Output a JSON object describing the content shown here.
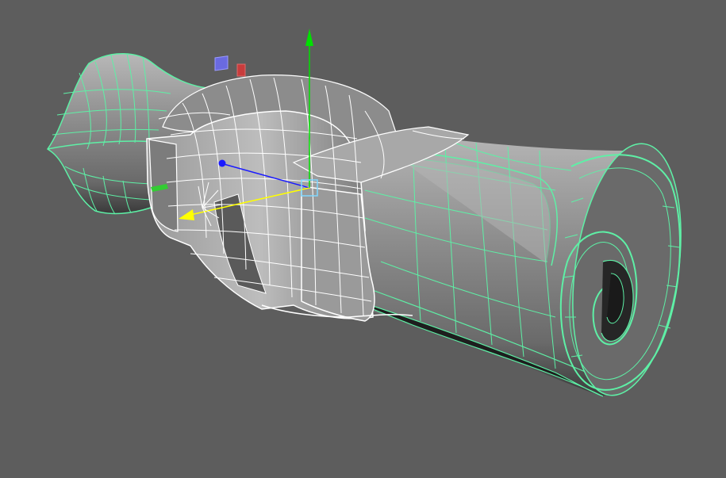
{
  "viewport": {
    "background": "#5d5d5d",
    "wireframe_selected_color": "#5ef0a6",
    "wireframe_active_color": "#ffffff",
    "surface_shade_light": "#b4b4b4",
    "surface_shade_dark": "#3a3a3a"
  },
  "gizmo": {
    "y_axis_color": "#00e000",
    "x_axis_color": "#1a1aff",
    "z_axis_color": "#ffff00",
    "red_handle_color": "#c83c3c",
    "blue_handle_color": "#6a6ae0",
    "green_handle_color": "#33cc33",
    "center_handle_color": "#7fd8ff",
    "icons": [
      "move-y-arrow-icon",
      "move-x-arrow-icon",
      "move-z-arrow-icon",
      "pivot-icon"
    ]
  }
}
